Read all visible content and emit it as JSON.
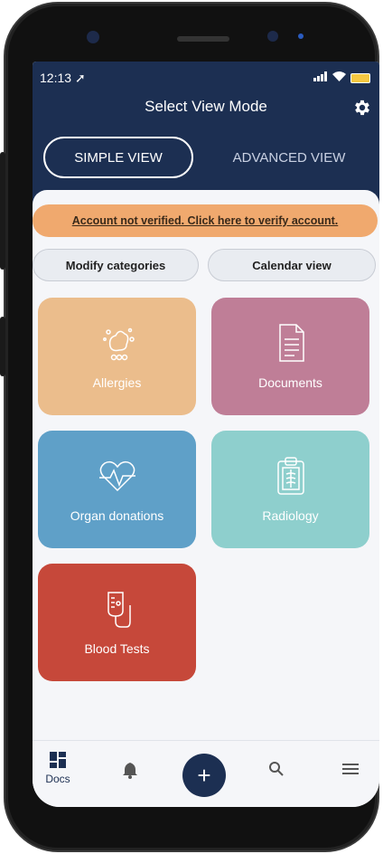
{
  "status_bar": {
    "time": "12:13",
    "location_glyph": "➚"
  },
  "header": {
    "title": "Select View Mode",
    "settings_icon": "gear-icon",
    "simple_view_label": "SIMPLE VIEW",
    "advanced_view_label": "ADVANCED VIEW"
  },
  "verify_banner": {
    "text": "Account not verified. Click here to verify account."
  },
  "actions": {
    "modify_categories": "Modify categories",
    "calendar_view": "Calendar view"
  },
  "tiles": [
    {
      "label": "Allergies",
      "color": "#ebbd8c",
      "icon": "allergy-icon"
    },
    {
      "label": "Documents",
      "color": "#bf7e97",
      "icon": "document-icon"
    },
    {
      "label": "Organ donations",
      "color": "#5fa0c8",
      "icon": "heart-icon"
    },
    {
      "label": "Radiology",
      "color": "#8ecfcd",
      "icon": "clipboard-icon"
    },
    {
      "label": "Blood Tests",
      "color": "#c6483a",
      "icon": "iv-bag-icon"
    }
  ],
  "bottom_nav": {
    "docs_label": "Docs",
    "items": [
      "docs-icon",
      "bell-icon",
      "add-icon",
      "search-icon",
      "menu-icon"
    ]
  },
  "colors": {
    "header": "#1c2f52",
    "banner": "#f0a96e",
    "background": "#f5f6f9"
  }
}
